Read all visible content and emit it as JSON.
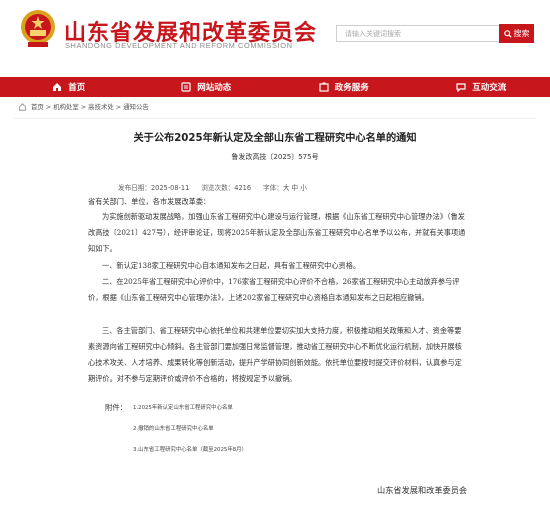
{
  "header": {
    "title": "山东省发展和改革委员会",
    "subtitle": "SHANDONG DEVELOPMENT AND REFORM COMMISSION",
    "search_placeholder": "请输入关键词搜索",
    "search_label": "搜索"
  },
  "nav": {
    "items": [
      {
        "label": "首页",
        "icon": "home-icon"
      },
      {
        "label": "网站动态",
        "icon": "news-icon"
      },
      {
        "label": "政务服务",
        "icon": "service-icon"
      },
      {
        "label": "互动交流",
        "icon": "chat-icon"
      }
    ]
  },
  "breadcrumb": {
    "text": "首页 > 机构处室 > 高技术处 > 通知公告"
  },
  "article": {
    "title": "关于公布2025年新认定及全部山东省工程研究中心名单的通知",
    "doc_number": "鲁发改高技〔2025〕575号",
    "meta": {
      "date_label": "发布日期：",
      "date": "2025-08-11",
      "views_label": "浏览次数：",
      "views": "4216",
      "font_label": "字体：",
      "font_options": "大  中  小"
    },
    "paragraphs": [
      "省有关部门、单位，各市发展改革委：",
      "为实施创新驱动发展战略，加强山东省工程研究中心建设与运行管理，根据《山东省工程研究中心管理办法》（鲁发改高技〔2021〕427号），经评审论证，现将2025年新认定及全部山东省工程研究中心名单予以公布，并就有关事项通知如下。",
      "一、新认定138家工程研究中心自本通知发布之日起，具有省工程研究中心资格。",
      "二、在2025年省工程研究中心评价中，176家省工程研究中心评价不合格，26家省工程研究中心主动放弃参与评价，根据《山东省工程研究中心管理办法》，上述202家省工程研究中心资格自本通知发布之日起相应撤销。",
      "三、各主管部门、省工程研究中心依托单位和共建单位要切实加大支持力度，积极推动相关政策和人才、资金等要素资源向省工程研究中心倾斜。各主管部门要加强日常监督管理，推动省工程研究中心不断优化运行机制，加快开展核心技术攻关、人才培养、成果转化等创新活动，提升产学研协同创新效能。依托单位要按时提交评价材料，认真参与定期评价。对不参与定期评价或评价不合格的，将按规定予以撤销。"
    ],
    "attachments_label": "附件：",
    "attachments": [
      "1.2025年新认定山东省工程研究中心名单",
      "2.撤销的山东省工程研究中心名单",
      "3.山东省工程研究中心名单（截至2025年8月）"
    ],
    "signer": "山东省发展和改革委员会"
  },
  "colors": {
    "brand_red": "#c8161d"
  }
}
